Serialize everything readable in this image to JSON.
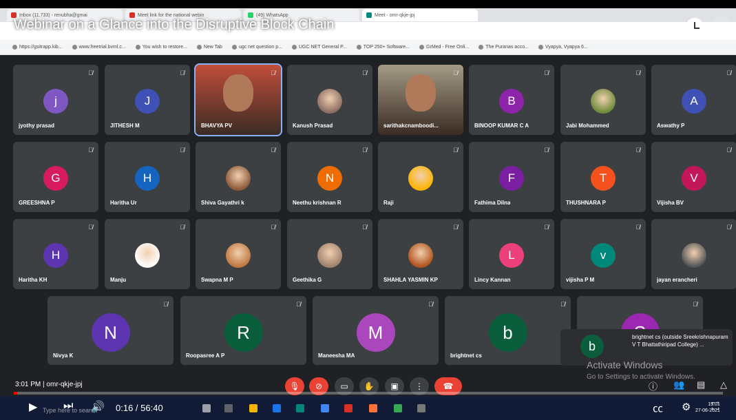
{
  "video_title": "Webinar on a Glance into the Disruptive Block Chain",
  "browser": {
    "tabs": [
      {
        "label": "Inbox (11,733) - renubha@gmai",
        "color": "#d93025"
      },
      {
        "label": "Meet link for the national webin",
        "color": "#d93025"
      },
      {
        "label": "(49) WhatsApp",
        "color": "#25d366"
      },
      {
        "label": "Meet - omr-qkje-jpj",
        "color": "#00897b"
      }
    ],
    "bookmarks": [
      "https://gsitrapp.kib...",
      "www.freetrial.bvml.c...",
      "You wish to restore...",
      "New Tab",
      "ugc net question p...",
      "UGC NET General P...",
      "TOP 250+ Software...",
      "GrMed - Free Onli...",
      "The Puranas acco...",
      "Vyapya, Vyapya 6..."
    ]
  },
  "participants_row1": [
    {
      "name": "jyothy prasad",
      "initial": "j",
      "color": "#7e57c2"
    },
    {
      "name": "JITHESH M",
      "initial": "J",
      "color": "#3f51b5"
    },
    {
      "name": "BHAVYA PV",
      "initial": "",
      "color": "#c24d3a",
      "video": true
    },
    {
      "name": "Kanush Prasad",
      "initial": "",
      "color": "#8d6e63",
      "photo": true
    },
    {
      "name": "sarithakcnamboodi...",
      "initial": "",
      "color": "#a39a86",
      "video": true
    },
    {
      "name": "BINOOP KUMAR C A",
      "initial": "B",
      "color": "#8e24aa"
    },
    {
      "name": "Jabi Mohammed",
      "initial": "",
      "color": "#6d8b3a",
      "photo": true
    },
    {
      "name": "Aswathy P",
      "initial": "A",
      "color": "#3f51b5"
    }
  ],
  "participants_row2": [
    {
      "name": "GREESHNA P",
      "initial": "G",
      "color": "#d81b60"
    },
    {
      "name": "Haritha Ur",
      "initial": "H",
      "color": "#1565c0"
    },
    {
      "name": "Shiva Gayathri k",
      "initial": "",
      "color": "#8d5a3b",
      "photo": true
    },
    {
      "name": "Neethu krishnan R",
      "initial": "N",
      "color": "#ef6c00"
    },
    {
      "name": "Raji",
      "initial": "",
      "color": "#ffb300",
      "photo": true
    },
    {
      "name": "Fathima Dilna",
      "initial": "F",
      "color": "#7b1fa2"
    },
    {
      "name": "THUSHNARA P",
      "initial": "T",
      "color": "#f4511e"
    },
    {
      "name": "Vijisha BV",
      "initial": "V",
      "color": "#c2185b"
    }
  ],
  "participants_row3": [
    {
      "name": "Haritha KH",
      "initial": "H",
      "color": "#5e35b1"
    },
    {
      "name": "Manju",
      "initial": "",
      "color": "#ffffff",
      "photo": true
    },
    {
      "name": "Swapna M P",
      "initial": "",
      "color": "#c0793f",
      "photo": true
    },
    {
      "name": "Geethika G",
      "initial": "",
      "color": "#a0826d",
      "photo": true
    },
    {
      "name": "SHAHLA YASMIN KP",
      "initial": "",
      "color": "#b3541e",
      "photo": true
    },
    {
      "name": "Lincy Kannan",
      "initial": "L",
      "color": "#ec407a"
    },
    {
      "name": "vijisha P M",
      "initial": "v",
      "color": "#00897b"
    },
    {
      "name": "jayan erancheri",
      "initial": "",
      "color": "#555555",
      "photo": true
    }
  ],
  "participants_row4": [
    {
      "name": "Nivya K",
      "initial": "N",
      "color": "#5e35b1"
    },
    {
      "name": "Roopasree A P",
      "initial": "R",
      "color": "#0b5e3c"
    },
    {
      "name": "Maneesha MA",
      "initial": "M",
      "color": "#ab47bc"
    },
    {
      "name": "brightnet cs",
      "initial": "b",
      "color": "#0b5e3c"
    },
    {
      "name": "",
      "initial": "S",
      "color": "#9c27b0"
    }
  ],
  "popup": {
    "initial": "b",
    "text": "brightnet cs (outside Sreekrishnapuram V T Bhattathiripad College) ..."
  },
  "watermark": {
    "line1": "Activate Windows",
    "line2": "Go to Settings to activate Windows."
  },
  "meeting": {
    "time": "3:01 PM",
    "code": "omr-qkje-jpj"
  },
  "player": {
    "current_time": "0:16",
    "duration": "56:40",
    "time_display": "0:16 / 56:40",
    "progress": 0.005,
    "search_placeholder": "Type here to search",
    "clock": "15:01",
    "date": "27-06-2021"
  }
}
